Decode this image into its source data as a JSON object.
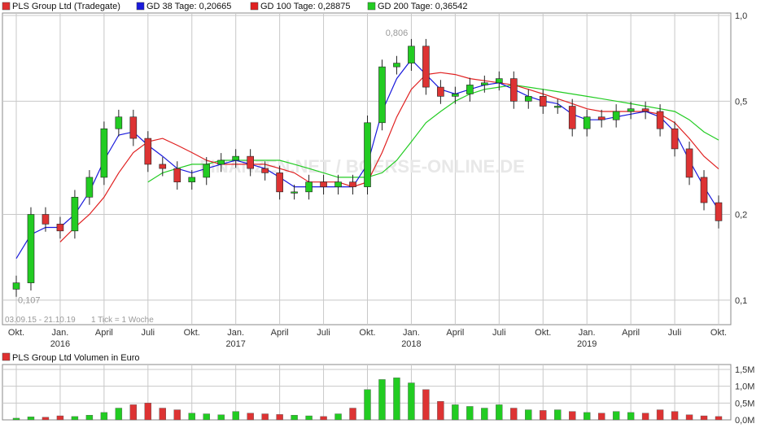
{
  "chart_data": [
    {
      "type": "candlestick",
      "legend": [
        {
          "label": "PLS Group Ltd (Tradegate)",
          "color": "#e03030"
        },
        {
          "label": "GD 38 Tage: 0,20665",
          "color": "#1a1adc"
        },
        {
          "label": "GD 100 Tage: 0,28875",
          "color": "#e02020"
        },
        {
          "label": "GD 200 Tage: 0,36542",
          "color": "#22cc22"
        }
      ],
      "y_scale": "log",
      "ylim": [
        0.082,
        1.02
      ],
      "y_ticks": [
        {
          "value": 1.0,
          "label": "1,0"
        },
        {
          "value": 0.5,
          "label": "0,5"
        },
        {
          "value": 0.2,
          "label": "0,2"
        },
        {
          "value": 0.1,
          "label": "0,1"
        }
      ],
      "x_months": [
        "2015-10",
        "2015-11",
        "2015-12",
        "2016-01",
        "2016-02",
        "2016-03",
        "2016-04",
        "2016-05",
        "2016-06",
        "2016-07",
        "2016-08",
        "2016-09",
        "2016-10",
        "2016-11",
        "2016-12",
        "2017-01",
        "2017-02",
        "2017-03",
        "2017-04",
        "2017-05",
        "2017-06",
        "2017-07",
        "2017-08",
        "2017-09",
        "2017-10",
        "2017-11",
        "2017-12",
        "2018-01",
        "2018-02",
        "2018-03",
        "2018-04",
        "2018-05",
        "2018-06",
        "2018-07",
        "2018-08",
        "2018-09",
        "2018-10",
        "2018-11",
        "2018-12",
        "2019-01",
        "2019-02",
        "2019-03",
        "2019-04",
        "2019-05",
        "2019-06",
        "2019-07",
        "2019-08",
        "2019-09",
        "2019-10"
      ],
      "closes": [
        0.115,
        0.2,
        0.185,
        0.175,
        0.23,
        0.27,
        0.4,
        0.44,
        0.37,
        0.3,
        0.29,
        0.26,
        0.27,
        0.3,
        0.31,
        0.32,
        0.29,
        0.28,
        0.24,
        0.24,
        0.26,
        0.25,
        0.26,
        0.25,
        0.42,
        0.66,
        0.68,
        0.78,
        0.56,
        0.52,
        0.53,
        0.57,
        0.58,
        0.6,
        0.5,
        0.52,
        0.48,
        0.48,
        0.4,
        0.44,
        0.43,
        0.46,
        0.47,
        0.46,
        0.4,
        0.34,
        0.27,
        0.22,
        0.19
      ],
      "gd38": [
        0.14,
        0.17,
        0.18,
        0.18,
        0.2,
        0.24,
        0.31,
        0.38,
        0.39,
        0.35,
        0.32,
        0.29,
        0.28,
        0.29,
        0.3,
        0.31,
        0.3,
        0.29,
        0.27,
        0.25,
        0.25,
        0.25,
        0.25,
        0.25,
        0.3,
        0.46,
        0.6,
        0.7,
        0.62,
        0.55,
        0.53,
        0.55,
        0.57,
        0.58,
        0.55,
        0.52,
        0.5,
        0.49,
        0.45,
        0.43,
        0.43,
        0.44,
        0.45,
        0.46,
        0.44,
        0.39,
        0.31,
        0.25,
        0.207
      ],
      "gd100": [
        null,
        null,
        null,
        0.16,
        0.18,
        0.2,
        0.23,
        0.28,
        0.33,
        0.36,
        0.37,
        0.35,
        0.33,
        0.31,
        0.3,
        0.3,
        0.3,
        0.3,
        0.29,
        0.28,
        0.26,
        0.26,
        0.26,
        0.25,
        0.26,
        0.33,
        0.44,
        0.55,
        0.62,
        0.63,
        0.62,
        0.6,
        0.59,
        0.58,
        0.57,
        0.55,
        0.53,
        0.51,
        0.49,
        0.47,
        0.46,
        0.46,
        0.46,
        0.46,
        0.45,
        0.42,
        0.37,
        0.32,
        0.289
      ],
      "gd200": [
        null,
        null,
        null,
        null,
        null,
        null,
        null,
        null,
        null,
        0.26,
        0.28,
        0.29,
        0.3,
        0.3,
        0.31,
        0.31,
        0.31,
        0.31,
        0.31,
        0.3,
        0.29,
        0.28,
        0.27,
        0.27,
        0.27,
        0.28,
        0.31,
        0.36,
        0.42,
        0.46,
        0.5,
        0.53,
        0.55,
        0.56,
        0.57,
        0.56,
        0.55,
        0.54,
        0.53,
        0.52,
        0.51,
        0.5,
        0.49,
        0.48,
        0.47,
        0.46,
        0.43,
        0.39,
        0.365
      ],
      "annotations": [
        {
          "text": "0,806",
          "x": "2017-12",
          "y": 0.806
        },
        {
          "text": "0,107",
          "x": "2015-10",
          "y": 0.107
        }
      ],
      "date_range": "03.09.15 - 21.10.19",
      "tick_note": "1 Tick = 1 Woche",
      "watermark": "FINANZEN.NET / BOERSE-ONLINE.DE"
    },
    {
      "type": "bar",
      "title": "PLS Group Ltd Volumen in Euro",
      "title_color": "#e03030",
      "ylim": [
        0,
        1.5
      ],
      "y_ticks": [
        {
          "value": 1.5,
          "label": "1,5M"
        },
        {
          "value": 1.0,
          "label": "1,0M"
        },
        {
          "value": 0.5,
          "label": "0,5M"
        },
        {
          "value": 0.0,
          "label": "0,0M"
        }
      ],
      "volumes": [
        0.05,
        0.09,
        0.08,
        0.12,
        0.1,
        0.14,
        0.22,
        0.35,
        0.45,
        0.5,
        0.35,
        0.3,
        0.2,
        0.18,
        0.15,
        0.25,
        0.2,
        0.18,
        0.16,
        0.14,
        0.12,
        0.1,
        0.18,
        0.35,
        0.9,
        1.2,
        1.25,
        1.1,
        0.9,
        0.55,
        0.45,
        0.4,
        0.35,
        0.45,
        0.35,
        0.3,
        0.28,
        0.3,
        0.25,
        0.22,
        0.2,
        0.25,
        0.22,
        0.2,
        0.3,
        0.25,
        0.15,
        0.12,
        0.1
      ]
    }
  ],
  "x_axis": {
    "month_labels": [
      "Okt.",
      "Jan.",
      "April",
      "Juli",
      "Okt.",
      "Jan.",
      "April",
      "Juli",
      "Okt.",
      "Jan.",
      "April",
      "Juli",
      "Okt.",
      "Jan.",
      "April",
      "Juli",
      "Okt."
    ],
    "year_labels": [
      "2016",
      "2017",
      "2018",
      "2019"
    ]
  },
  "colors": {
    "up": "#22cc22",
    "down": "#dd3333",
    "border": "#333333",
    "grid": "#c8c8c8",
    "axis_text": "#333333"
  }
}
